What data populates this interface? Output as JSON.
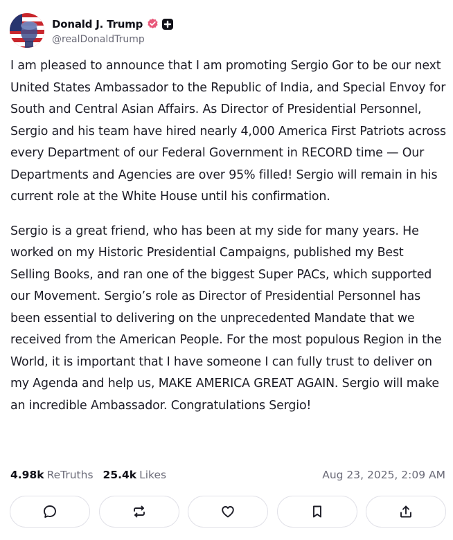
{
  "author": {
    "display_name": "Donald J. Trump",
    "handle": "@realDonaldTrump",
    "verified_badge_color": "#e8587a"
  },
  "post": {
    "paragraphs": [
      "I am pleased to announce that I am promoting Sergio Gor to be our next United States Ambassador to the Republic of India, and Special Envoy for South and Central Asian Affairs. As Director of Presidential Personnel, Sergio and his team have hired nearly 4,000 America First Patriots across every Department of our Federal Government in RECORD time — Our Departments and Agencies are over 95% filled! Sergio will remain in his current role at the White House until his confirmation.",
      "Sergio is a great friend, who has been at my side for many years. He worked on my Historic Presidential Campaigns, published my Best Selling Books, and ran one of the biggest Super PACs, which supported our Movement. Sergio’s role as Director of Presidential Personnel has been essential to delivering on the unprecedented Mandate that we received from the American People. For the most populous Region in the World, it is important that I have someone I can fully trust to deliver on my Agenda and help us, MAKE AMERICA GREAT AGAIN. Sergio will make an incredible Ambassador. Congratulations Sergio!"
    ]
  },
  "stats": {
    "retruths_count": "4.98k",
    "retruths_label": "ReTruths",
    "likes_count": "25.4k",
    "likes_label": "Likes",
    "timestamp": "Aug 23, 2025, 2:09 AM"
  },
  "actions": [
    {
      "name": "reply-button",
      "icon": "comment-icon"
    },
    {
      "name": "retruth-button",
      "icon": "repost-icon"
    },
    {
      "name": "like-button",
      "icon": "heart-icon"
    },
    {
      "name": "bookmark-button",
      "icon": "bookmark-icon"
    },
    {
      "name": "share-button",
      "icon": "share-icon"
    }
  ]
}
